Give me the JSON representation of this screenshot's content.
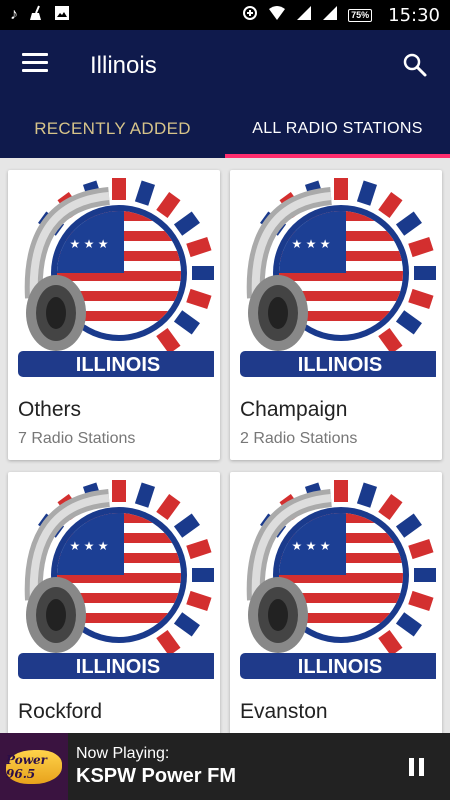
{
  "status_bar": {
    "time": "15:30",
    "battery": "75%",
    "icons": [
      "music-note-icon",
      "broom-icon",
      "image-icon",
      "data-saver-icon",
      "wifi-icon",
      "signal-icon",
      "signal-icon"
    ]
  },
  "header": {
    "title": "Illinois",
    "menu_icon": "hamburger-menu-icon",
    "search_icon": "search-icon"
  },
  "tabs": [
    {
      "label": "RECENTLY ADDED",
      "active": false
    },
    {
      "label": "ALL RADIO STATIONS",
      "active": true
    }
  ],
  "colors": {
    "app_bar": "#0f1a4c",
    "tab_indicator": "#ff2d6e",
    "inactive_tab": "#d7c48a"
  },
  "cards": [
    {
      "name": "Others",
      "count": "7 Radio Stations",
      "badge": "ILLINOIS"
    },
    {
      "name": "Champaign",
      "count": "2 Radio Stations",
      "badge": "ILLINOIS"
    },
    {
      "name": "Rockford",
      "count": "",
      "badge": "ILLINOIS"
    },
    {
      "name": "Evanston",
      "count": "",
      "badge": "ILLINOIS"
    }
  ],
  "player": {
    "label": "Now Playing:",
    "station": "KSPW Power FM",
    "logo_text": "Power 96.5",
    "pause_icon": "pause-icon"
  }
}
